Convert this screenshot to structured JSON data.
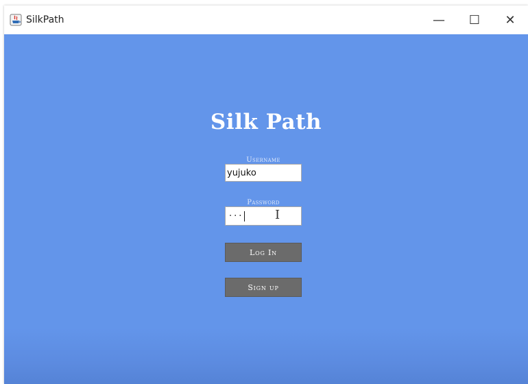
{
  "window": {
    "title": "SilkPath",
    "minimize_glyph": "—",
    "maximize_glyph": "☐",
    "close_glyph": "✕"
  },
  "login": {
    "heading": "Silk Path",
    "username_label": "Username",
    "username_value": "yujuko",
    "password_label": "Password",
    "password_masked": "···",
    "login_button": "Log In",
    "signup_button": "Sign up"
  },
  "icons": {
    "app": "java-app-icon",
    "text_cursor": "i-beam-cursor-icon"
  },
  "colors": {
    "background": "#6395ea",
    "heading": "#ffffff",
    "button": "#6b6b6b",
    "button_text": "#ffffff"
  }
}
